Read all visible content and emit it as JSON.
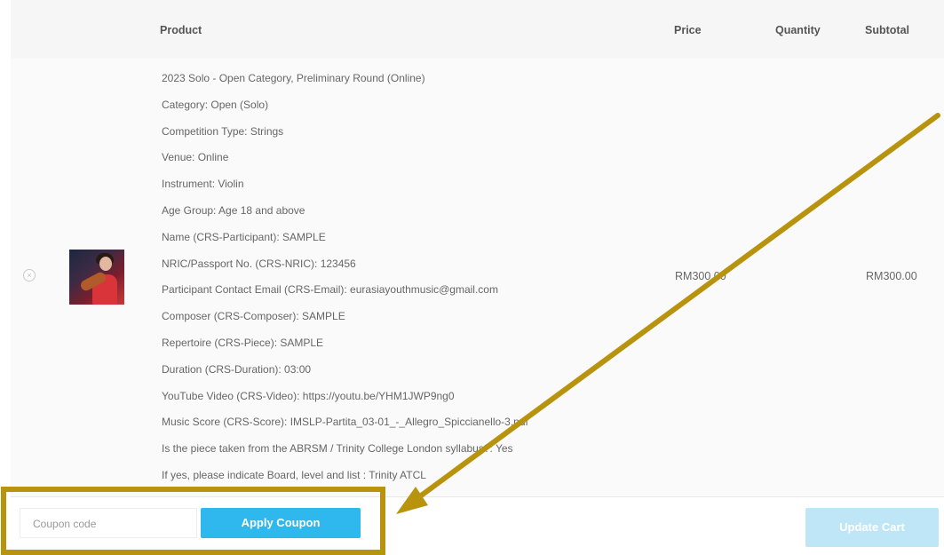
{
  "table": {
    "headers": {
      "product": "Product",
      "price": "Price",
      "quantity": "Quantity",
      "subtotal": "Subtotal"
    },
    "row": {
      "remove_symbol": "×",
      "product_details": [
        "2023 Solo - Open Category, Preliminary Round (Online)",
        "Category: Open (Solo)",
        "Competition Type: Strings",
        "Venue: Online",
        "Instrument: Violin",
        "Age Group: Age 18 and above",
        "Name (CRS-Participant): SAMPLE",
        "NRIC/Passport No. (CRS-NRIC): 123456",
        "Participant Contact Email (CRS-Email): eurasiayouthmusic@gmail.com",
        "Composer (CRS-Composer): SAMPLE",
        "Repertoire (CRS-Piece): SAMPLE",
        "Duration (CRS-Duration): 03:00",
        "YouTube Video (CRS-Video): https://youtu.be/YHM1JWP9ng0",
        "Music Score (CRS-Score): IMSLP-Partita_03-01_-_Allegro_Spiccianello-3.pdf",
        "Is the piece taken from the ABRSM / Trinity College London syllabus?: Yes",
        "If yes, please indicate Board, level and list : Trinity ATCL"
      ],
      "price": "RM300.00",
      "subtotal": "RM300.00"
    }
  },
  "coupon": {
    "placeholder": "Coupon code",
    "apply_label": "Apply Coupon"
  },
  "update_cart_label": "Update Cart",
  "colors": {
    "accent": "#2eb8ee",
    "annotation": "#b8930e"
  }
}
